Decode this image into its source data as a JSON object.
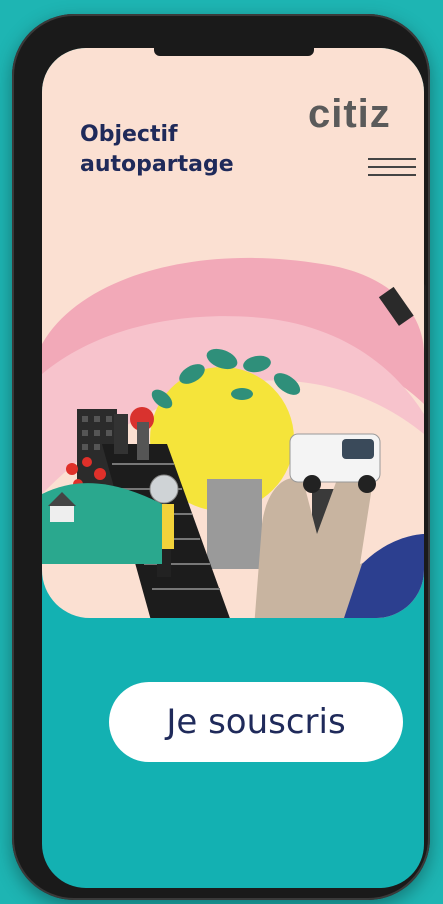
{
  "header": {
    "tagline_line1": "Objectif",
    "tagline_line2": "autopartage",
    "logo": "citiz",
    "menu_icon": "hamburger-menu-icon"
  },
  "hero": {
    "image": "collage-illustration"
  },
  "cta": {
    "label": "Je souscris"
  },
  "colors": {
    "background": "#1eb5b3",
    "hero_bg": "#fbe0d2",
    "brand_text": "#1f2a5a",
    "logo_text": "#5a5a5a",
    "button_bg": "#ffffff"
  }
}
